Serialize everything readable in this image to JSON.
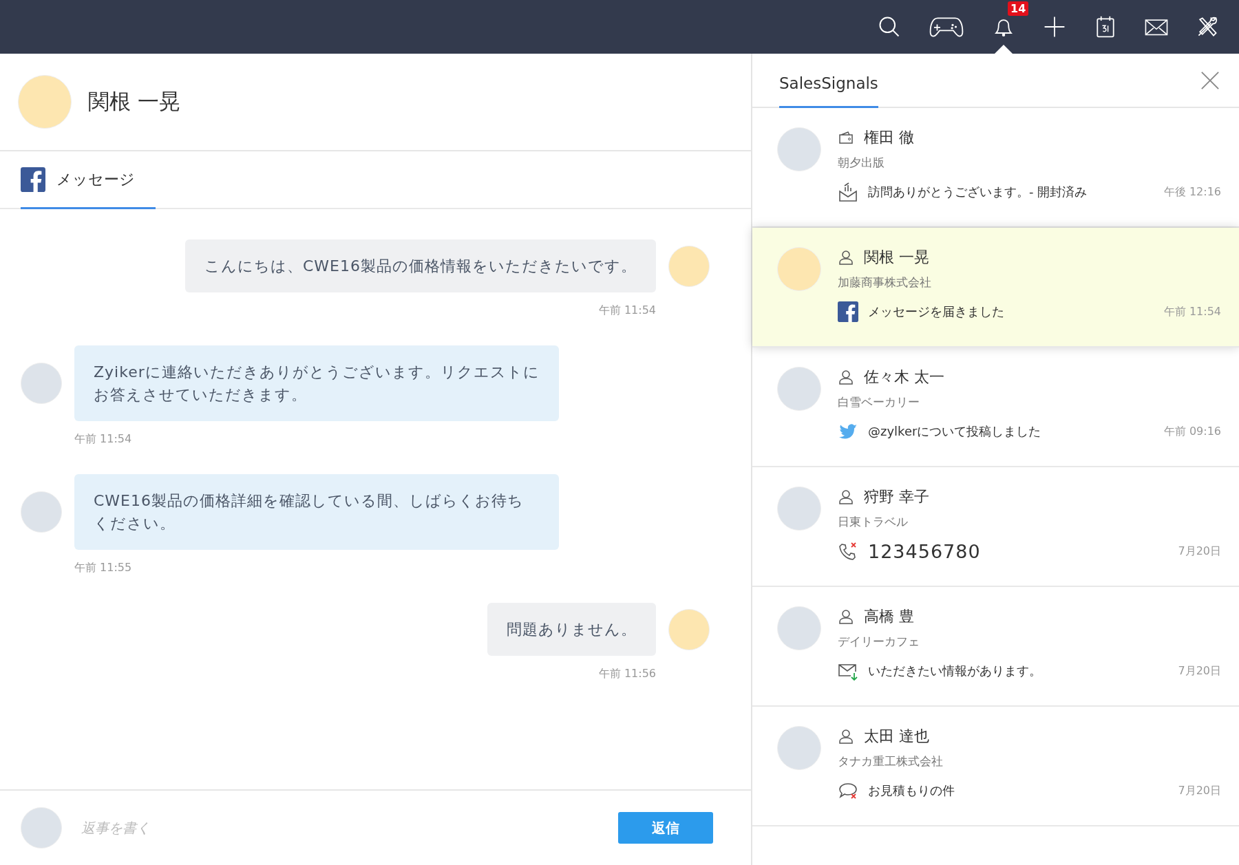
{
  "topbar": {
    "notification_count": "14"
  },
  "contact": {
    "name": "関根 一晃"
  },
  "tabs": [
    {
      "label": "メッセージ",
      "selected": true
    }
  ],
  "messages": [
    {
      "kind": "outgoing",
      "text": "こんにちは、CWE16製品の価格情報をいただきたいです。",
      "time": "午前 11:54"
    },
    {
      "kind": "incoming",
      "text": "Zyikerに連絡いただきありがとうございます。リクエストにお答えさせていただきます。",
      "time": "午前 11:54"
    },
    {
      "kind": "incoming",
      "text": "CWE16製品の価格詳細を確認している間、しばらくお待ちください。",
      "time": "午前 11:55"
    },
    {
      "kind": "outgoing",
      "text": "問題ありません。",
      "time": "午前 11:56"
    }
  ],
  "reply": {
    "placeholder": "返事を書く",
    "button": "返信"
  },
  "signals": {
    "title": "SalesSignals",
    "items": [
      {
        "kind": "account",
        "name": "権田 徹",
        "company": "朝夕出版",
        "activity": {
          "kind": "email-opened",
          "text": "訪問ありがとうございます。- 開封済み",
          "time": "午後 12:16"
        },
        "selected": false
      },
      {
        "kind": "contact",
        "name": "関根 一晃",
        "company": "加藤商事株式会社",
        "activity": {
          "kind": "facebook",
          "text": "メッセージを届きました",
          "time": "午前 11:54"
        },
        "selected": true
      },
      {
        "kind": "contact",
        "name": "佐々木 太一",
        "company": "白雪ベーカリー",
        "activity": {
          "kind": "twitter",
          "text": "@zylkerについて投稿しました",
          "time": "午前 09:16"
        },
        "selected": false
      },
      {
        "kind": "contact",
        "name": "狩野 幸子",
        "company": "日東トラベル",
        "activity": {
          "kind": "missed-call",
          "text": "123456780",
          "time": "7月20日"
        },
        "selected": false
      },
      {
        "kind": "contact",
        "name": "高橋 豊",
        "company": "デイリーカフェ",
        "activity": {
          "kind": "email-received",
          "text": "いただきたい情報があります。",
          "time": "7月20日"
        },
        "selected": false
      },
      {
        "kind": "contact",
        "name": "太田 達也",
        "company": "タナカ重工株式会社",
        "activity": {
          "kind": "missed-chat",
          "text": "お見積もりの件",
          "time": "7月20日"
        },
        "selected": false
      }
    ]
  }
}
